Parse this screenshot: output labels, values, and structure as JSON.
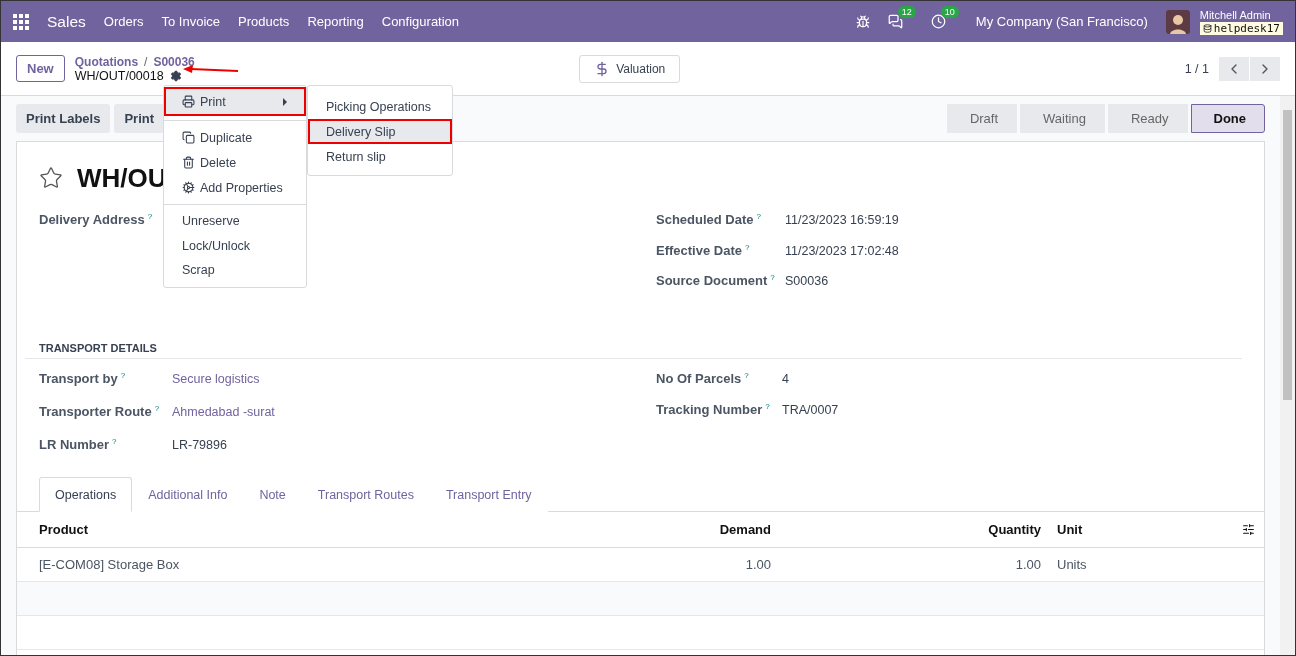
{
  "navbar": {
    "app": "Sales",
    "menu": [
      "Orders",
      "To Invoice",
      "Products",
      "Reporting",
      "Configuration"
    ],
    "messages_count": "12",
    "activities_count": "10",
    "company": "My Company (San Francisco)",
    "user": "Mitchell Admin",
    "database": "helpdesk17"
  },
  "control_panel": {
    "new_button": "New",
    "breadcrumb": [
      "Quotations",
      "S00036"
    ],
    "breadcrumb_separator": "/",
    "record": "WH/OUT/00018",
    "annotation_arrow": true,
    "smart_button": "Valuation",
    "pager": "1 / 1"
  },
  "action_buttons": [
    "Print Labels",
    "Print"
  ],
  "status": [
    {
      "label": "Draft",
      "selected": false
    },
    {
      "label": "Waiting",
      "selected": false
    },
    {
      "label": "Ready",
      "selected": false
    },
    {
      "label": "Done",
      "selected": true
    }
  ],
  "title": "WH/OU",
  "starred": false,
  "fields_left": [
    {
      "label": "Delivery Address",
      "help": "?"
    }
  ],
  "fields_right": [
    {
      "label": "Scheduled Date",
      "help": "?",
      "value": "11/23/2023 16:59:19"
    },
    {
      "label": "Effective Date",
      "help": "?",
      "value": "11/23/2023 17:02:48"
    },
    {
      "label": "Source Document",
      "help": "?",
      "value": "S00036"
    }
  ],
  "section": "TRANSPORT DETAILS",
  "transport_left": [
    {
      "label": "Transport by",
      "help": "?",
      "value": "Secure logistics",
      "kind": "link"
    },
    {
      "label": "Transporter Route",
      "help": "?",
      "value": "Ahmedabad -surat",
      "kind": "link"
    },
    {
      "label": "LR Number",
      "help": "?",
      "value": "LR-79896",
      "kind": "text"
    }
  ],
  "transport_right": [
    {
      "label": "No Of Parcels",
      "help": "?",
      "value": "4"
    },
    {
      "label": "Tracking Number",
      "help": "?",
      "value": "TRA/0007"
    }
  ],
  "tabs": [
    {
      "label": "Operations",
      "selected": true
    },
    {
      "label": "Additional Info",
      "selected": false
    },
    {
      "label": "Note",
      "selected": false
    },
    {
      "label": "Transport Routes",
      "selected": false
    },
    {
      "label": "Transport Entry",
      "selected": false
    }
  ],
  "table": {
    "columns": [
      "Product",
      "Demand",
      "Quantity",
      "Unit"
    ],
    "rows": [
      [
        "[E-COM08] Storage Box",
        "1.00",
        "1.00",
        "Units"
      ]
    ]
  },
  "gear_menu": {
    "items": [
      {
        "label": "Print",
        "kind": "submenu",
        "highlighted": true
      },
      {
        "kind": "divider"
      },
      {
        "label": "Duplicate",
        "kind": "copy"
      },
      {
        "label": "Delete",
        "kind": "trash"
      },
      {
        "label": "Add Properties",
        "kind": "gears"
      },
      {
        "kind": "divider"
      },
      {
        "label": "Unreserve",
        "kind": "plain"
      },
      {
        "label": "Lock/Unlock",
        "kind": "plain"
      },
      {
        "label": "Scrap",
        "kind": "plain"
      }
    ],
    "submenu": [
      {
        "label": "Picking Operations",
        "selected": false,
        "highlighted": false
      },
      {
        "label": "Delivery Slip",
        "selected": true,
        "highlighted": true
      },
      {
        "label": "Return slip",
        "selected": false,
        "highlighted": false
      }
    ]
  }
}
